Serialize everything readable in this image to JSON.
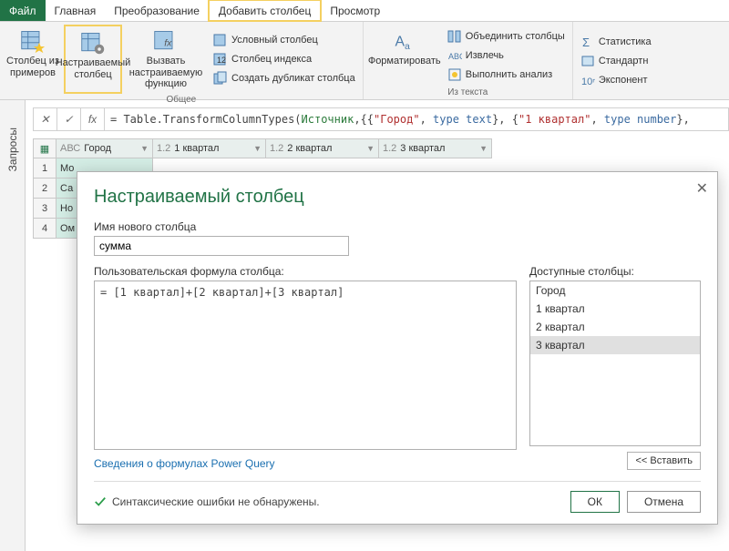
{
  "tabs": {
    "file": "Файл",
    "home": "Главная",
    "transform": "Преобразование",
    "addcol": "Добавить столбец",
    "view": "Просмотр"
  },
  "ribbon": {
    "col_from_examples": "Столбец из примеров",
    "custom_column": "Настраиваемый столбец",
    "invoke_custom_fn": "Вызвать настраиваемую функцию",
    "conditional_col": "Условный столбец",
    "index_col": "Столбец индекса",
    "duplicate_col": "Создать дубликат столбца",
    "group_general": "Общее",
    "format": "Форматировать",
    "merge_cols": "Объединить столбцы",
    "extract": "Извлечь",
    "analyze": "Выполнить анализ",
    "group_fromtext": "Из текста",
    "statistics": "Статистика",
    "standard": "Стандартн",
    "exponent": "Экспонент"
  },
  "formula_bar": {
    "fx": "fx",
    "prefix": "= Table.TransformColumnTypes(",
    "src": "Источник",
    "s1": "\"Город\"",
    "t1": "type text",
    "s2": "\"1 квартал\"",
    "t2": "type number"
  },
  "side_panel": "Запросы",
  "columns": {
    "c0_type": "AВС",
    "c0": "Город",
    "c1_type": "1.2",
    "c1": "1 квартал",
    "c2_type": "1.2",
    "c2": "2 квартал",
    "c3_type": "1.2",
    "c3": "3 квартал"
  },
  "rows": {
    "r1": "Мо",
    "r2": "Са",
    "r3": "Но",
    "r4": "Ом"
  },
  "dialog": {
    "title": "Настраиваемый столбец",
    "name_label": "Имя нового столбца",
    "name_value": "сумма",
    "formula_label": "Пользовательская формула столбца:",
    "formula_value": "= [1 квартал]+[2 квартал]+[3 квартал]",
    "avail_label": "Доступные столбцы:",
    "avail": {
      "a0": "Город",
      "a1": "1 квартал",
      "a2": "2 квартал",
      "a3": "3 квартал"
    },
    "insert": "<< Вставить",
    "learn_link": "Сведения о формулах Power Query",
    "status": "Синтаксические ошибки не обнаружены.",
    "ok": "ОК",
    "cancel": "Отмена"
  }
}
